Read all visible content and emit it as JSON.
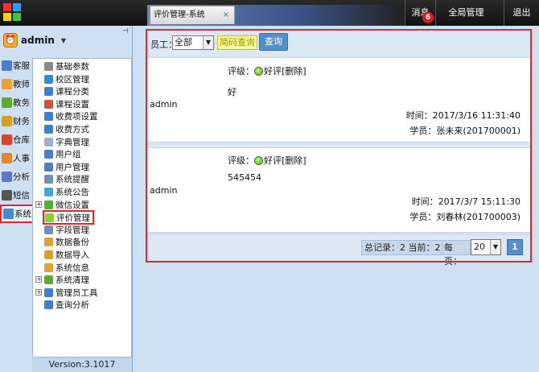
{
  "header": {
    "tab_label": "评价管理-系统",
    "tab_close": "×",
    "messages_label": "消息",
    "messages_badge": "6",
    "global_manage_label": "全局管理",
    "logout_label": "退出"
  },
  "user": {
    "name": "admin",
    "caret": "▼",
    "pin": "📌"
  },
  "categories": [
    {
      "label": "客服",
      "color": "#4a7fc8"
    },
    {
      "label": "教师",
      "color": "#e8a33c"
    },
    {
      "label": "教务",
      "color": "#5fa832"
    },
    {
      "label": "财务",
      "color": "#d4a21a"
    },
    {
      "label": "仓库",
      "color": "#d8422e"
    },
    {
      "label": "人事",
      "color": "#e08a2a"
    },
    {
      "label": "分析",
      "color": "#5f77c8"
    },
    {
      "label": "短信",
      "color": "#555555"
    },
    {
      "label": "系统",
      "color": "#4d86c9"
    }
  ],
  "tree": [
    {
      "label": "基础参数",
      "color": "#8a8a8a"
    },
    {
      "label": "校区管理",
      "color": "#2e8bd8"
    },
    {
      "label": "课程分类",
      "color": "#3f7fd0"
    },
    {
      "label": "课程设置",
      "color": "#c8553a"
    },
    {
      "label": "收费项设置",
      "color": "#3f7fd0"
    },
    {
      "label": "收费方式",
      "color": "#3f7fd0"
    },
    {
      "label": "字典管理",
      "color": "#9ab3cf"
    },
    {
      "label": "用户组",
      "color": "#4a7fc8"
    },
    {
      "label": "用户管理",
      "color": "#4a7fc8"
    },
    {
      "label": "系统提醒",
      "color": "#6f8fb8"
    },
    {
      "label": "系统公告",
      "color": "#3fa9d8"
    },
    {
      "label": "微信设置",
      "color": "#4fb530"
    },
    {
      "label": "评价管理",
      "color": "#8fcf3f"
    },
    {
      "label": "字段管理",
      "color": "#6f8fb8"
    },
    {
      "label": "数据备份",
      "color": "#e3a12a"
    },
    {
      "label": "数据导入",
      "color": "#d8a21f"
    },
    {
      "label": "系统信息",
      "color": "#e3a12a"
    },
    {
      "label": "系统清理",
      "color": "#5fa832"
    },
    {
      "label": "管理员工具",
      "color": "#3f7fd0"
    },
    {
      "label": "查询分析",
      "color": "#3f7fd0"
    }
  ],
  "tree_expanders": {
    "wechat": "+",
    "cleanup": "+",
    "admin_tools": "+"
  },
  "version": "Version:3.1017",
  "filter": {
    "employee_label": "员工：",
    "employee_value": "全部",
    "pinyin_query": "简码查询",
    "query_button": "查询"
  },
  "reviews": [
    {
      "rating_label": "评级：",
      "rating_value": "好评",
      "delete_link": "[删除]",
      "comment": "好",
      "author": "admin",
      "time": "时间：2017/3/16 11:31:40",
      "student": "学员：张未来(201700001)"
    },
    {
      "rating_label": "评级：",
      "rating_value": "好评",
      "delete_link": "[删除]",
      "comment": "545454",
      "author": "admin",
      "time": "时间：2017/3/7 15:11:30",
      "student": "学员：刘春林(201700003)"
    }
  ],
  "pager": {
    "total": "总记录：2 当前：2",
    "page_size_label": "每页：",
    "page_size": "20",
    "page": "1"
  },
  "arrows": {
    "select": "▼"
  }
}
